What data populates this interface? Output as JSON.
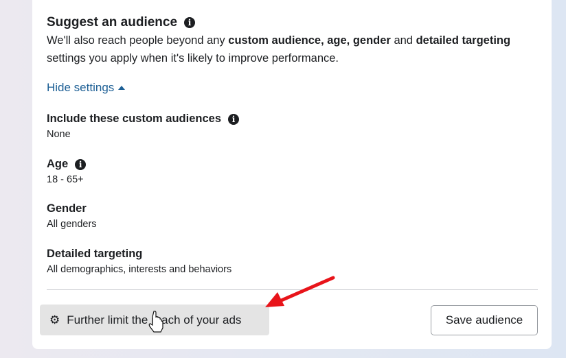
{
  "section": {
    "title": "Suggest an audience",
    "description": {
      "t1": "We'll also reach people beyond any ",
      "b1": "custom audience, age, gender",
      "t2": " and ",
      "b2": "detailed targeting",
      "t3": " settings you apply when it's likely to improve performance."
    },
    "toggle_label": "Hide settings"
  },
  "settings": [
    {
      "label": "Include these custom audiences",
      "value": "None",
      "info": true
    },
    {
      "label": "Age",
      "value": "18 - 65+",
      "info": true
    },
    {
      "label": "Gender",
      "value": "All genders",
      "info": false
    },
    {
      "label": "Detailed targeting",
      "value": "All demographics, interests and behaviors",
      "info": false
    }
  ],
  "footer": {
    "limit_button": "Further limit the reach of your ads",
    "save_button": "Save audience"
  },
  "colors": {
    "link": "#1d5f95",
    "annotation_arrow": "#e8141a"
  }
}
